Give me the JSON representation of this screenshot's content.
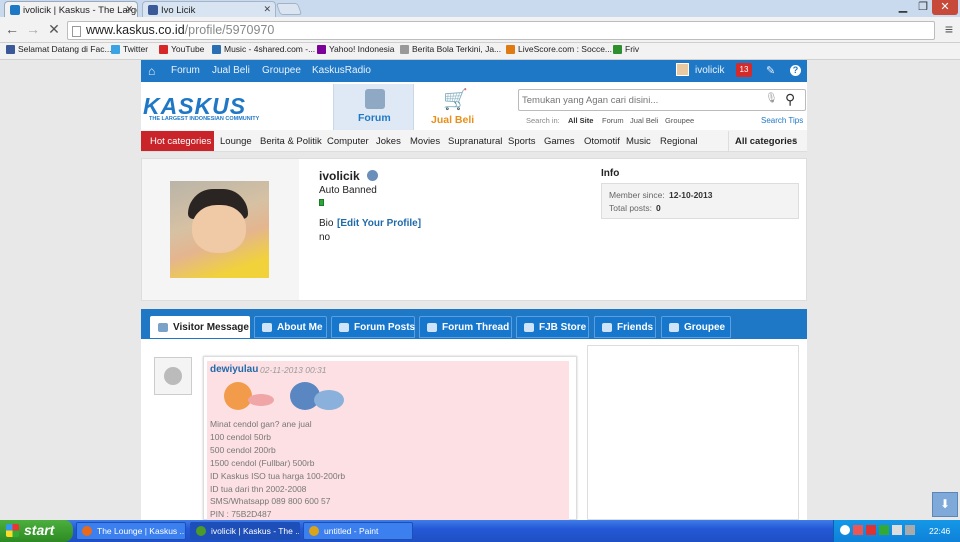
{
  "browser": {
    "tabs": [
      {
        "label": "ivolicik | Kaskus - The Larges"
      },
      {
        "label": "Ivo Licik"
      }
    ],
    "url_host": "www.kaskus.co.id",
    "url_path": "/profile/5970970",
    "bookmarks": [
      {
        "label": "Selamat Datang di Fac...",
        "color": "#3b5998"
      },
      {
        "label": "Twitter",
        "color": "#3aa3e3"
      },
      {
        "label": "YouTube",
        "color": "#d62828"
      },
      {
        "label": "Music - 4shared.com -...",
        "color": "#2b6fb3"
      },
      {
        "label": "Yahoo! Indonesia",
        "color": "#7b0099"
      },
      {
        "label": "Berita Bola Terkini, Ja...",
        "color": "#999999"
      },
      {
        "label": "LiveScore.com : Socce...",
        "color": "#e07b14"
      },
      {
        "label": "Friv",
        "color": "#2d8f2d"
      }
    ]
  },
  "topnav": {
    "links": [
      "Forum",
      "Jual Beli",
      "Groupee",
      "KaskusRadio"
    ],
    "user": "ivolicik",
    "notif_count": "13"
  },
  "header": {
    "logo_text": "KASKUS",
    "logo_tagline": "THE LARGEST INDONESIAN COMMUNITY",
    "forum_label": "Forum",
    "jualbeli_label": "Jual Beli",
    "search_placeholder": "Temukan yang Agan cari disini...",
    "search_in_label": "Search in:",
    "search_scopes": [
      "All Site",
      "Forum",
      "Jual Beli",
      "Groupee"
    ],
    "search_tips": "Search Tips"
  },
  "categories": {
    "hot_label": "Hot categories",
    "items": [
      "Lounge",
      "Berita & Politik",
      "Computer",
      "Jokes",
      "Movies",
      "Supranatural",
      "Sports",
      "Games",
      "Otomotif",
      "Music",
      "Regional"
    ],
    "all_label": "All categories"
  },
  "profile": {
    "username": "ivolicik",
    "status": "Auto Banned",
    "bio_label": "Bio",
    "edit_link": "[Edit Your Profile]",
    "bio_text": "no",
    "info_title": "Info",
    "member_since_label": "Member since:",
    "member_since": "12-10-2013",
    "total_posts_label": "Total posts:",
    "total_posts": "0"
  },
  "profile_tabs": [
    "Visitor Message",
    "About Me",
    "Forum Posts",
    "Forum Thread",
    "FJB Store",
    "Friends",
    "Groupee"
  ],
  "message": {
    "author": "dewiyulau",
    "date": "02-11-2013 00:31",
    "lines": [
      "Minat cendol gan? ane jual",
      "100 cendol 50rb",
      "500 cendol 200rb",
      "1500 cendol (Fullbar) 500rb",
      "ID Kaskus ISO tua harga 100-200rb",
      "ID tua dari thn 2002-2008",
      "SMS/Whatsapp 089 800 600 57",
      "PIN : 75B2D487"
    ]
  },
  "taskbar": {
    "start_label": "start",
    "items": [
      {
        "label": "The Lounge | Kaskus ...",
        "color": "#e86a1a"
      },
      {
        "label": "ivolicik | Kaskus - The ...",
        "color": "#4c9a2a"
      },
      {
        "label": "untitled - Paint",
        "color": "#d9a31a"
      }
    ],
    "clock": "22:46"
  }
}
